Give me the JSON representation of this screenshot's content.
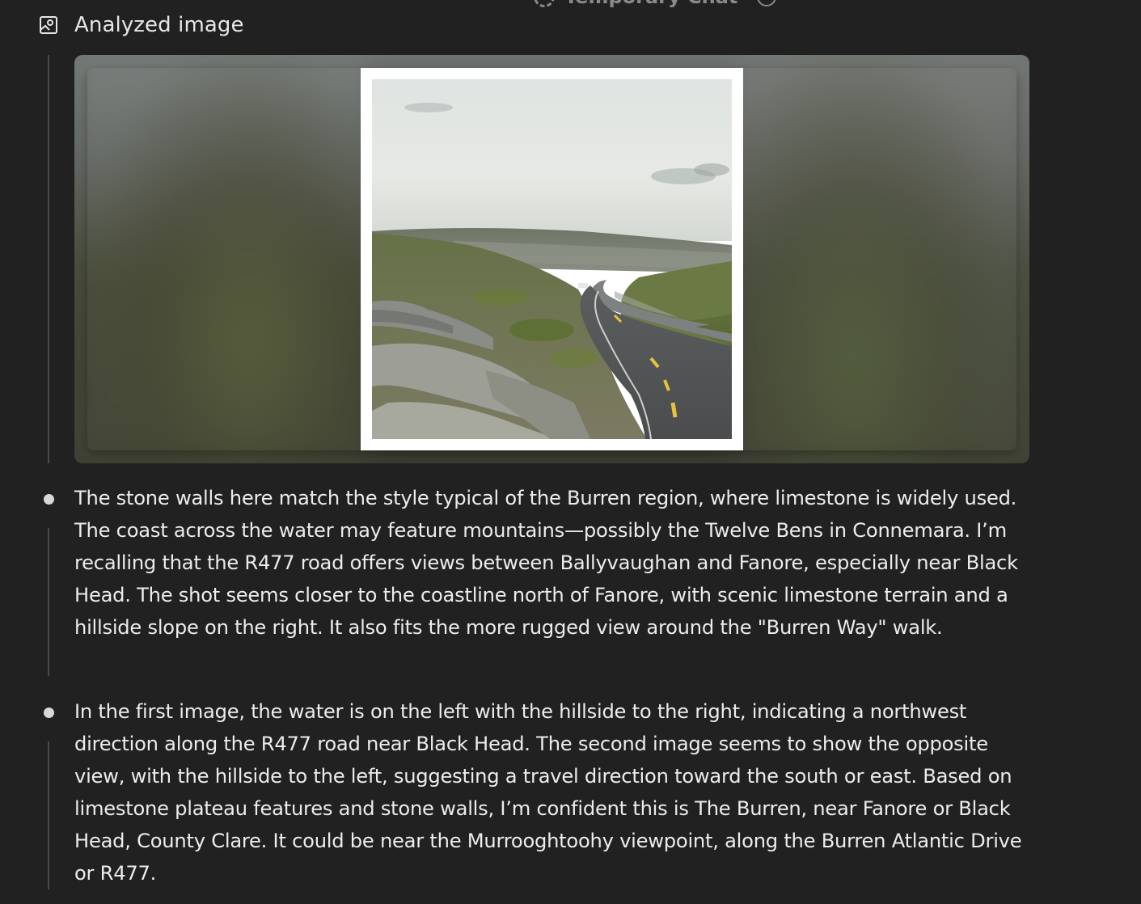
{
  "header": {
    "title": "Temporary Chat"
  },
  "analyzed": {
    "label": "Analyzed image"
  },
  "bullets": [
    "The stone walls here match the style typical of the Burren region, where limestone is widely used. The coast across the water may feature mountains—possibly the Twelve Bens in Connemara. I’m recalling that the R477 road offers views between Ballyvaughan and Fanore, especially near Black Head. The shot seems closer to the coastline north of Fanore, with scenic limestone terrain and a hillside slope on the right. It also fits the more rugged view around the \"Burren Way\" walk.",
    "In the first image, the water is on the left with the hillside to the right, indicating a northwest direction along the R477 road near Black Head. The second image seems to show the opposite view, with the hillside to the left, suggesting a travel direction toward the south or east. Based on limestone plateau features and stone walls, I’m confident this is The Burren, near Fanore or Black Head, County Clare. It could be near the Murrooghtoohy viewpoint, along the Burren Atlantic Drive or R477."
  ],
  "colors": {
    "background": "#212121",
    "text": "#ececec",
    "thread_line": "#4a4a4a"
  },
  "icons": {
    "header_left": "temporary-chat-icon",
    "header_right": "info-icon",
    "analyzed": "image-icon"
  }
}
